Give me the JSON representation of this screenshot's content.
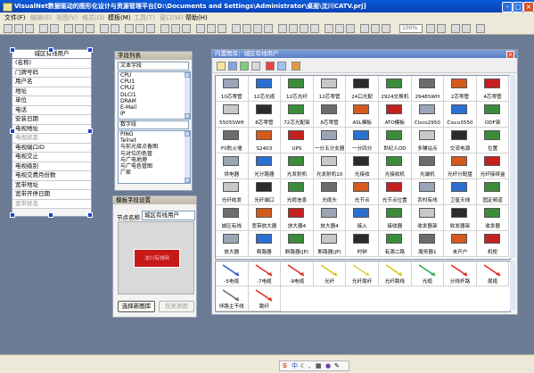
{
  "window": {
    "title": "VisualNet数据驱动的图形化设计与资源管理平台[D:\\Documents and Settings\\Administrator\\桌面\\沈川CATV.prj]"
  },
  "menu": [
    {
      "label": "文件(F)",
      "enabled": true
    },
    {
      "label": "编辑(E)",
      "enabled": false
    },
    {
      "label": "视图(V)",
      "enabled": false
    },
    {
      "label": "格式(O)",
      "enabled": false
    },
    {
      "label": "模板(M)",
      "enabled": true
    },
    {
      "label": "工具(T)",
      "enabled": false
    },
    {
      "label": "窗口(W)",
      "enabled": false
    },
    {
      "label": "帮助(H)",
      "enabled": true
    }
  ],
  "toolbar": {
    "zoom": "100%"
  },
  "form_panel": {
    "title": "城区有线用户",
    "rows": [
      {
        "label": "(名称)",
        "dim": false
      },
      {
        "label": "门牌号码",
        "dim": false
      },
      {
        "label": "用户名",
        "dim": false
      },
      {
        "label": "地址",
        "dim": false
      },
      {
        "label": "单位",
        "dim": false
      },
      {
        "label": "电话",
        "dim": false
      },
      {
        "label": "安装日期",
        "dim": false
      },
      {
        "label": "电视地址",
        "dim": false
      },
      {
        "label": "电视状态",
        "dim": true
      },
      {
        "label": "电视端口ID",
        "dim": false
      },
      {
        "label": "电视交止",
        "dim": false
      },
      {
        "label": "电视级别",
        "dim": false
      },
      {
        "label": "电视交费月份数",
        "dim": false
      },
      {
        "label": "宽带地址",
        "dim": false
      },
      {
        "label": "宽带开停日期",
        "dim": false
      },
      {
        "label": "宽带状态",
        "dim": true
      }
    ]
  },
  "field_list": {
    "title": "字段列表",
    "combo1": "文本字段",
    "list1": [
      "CPU",
      "CPU1",
      "CPU2",
      "DLCI1",
      "DRAM",
      "E-Mail",
      "IP"
    ],
    "combo2": "数字段",
    "list2": [
      "PING",
      "Telnet",
      "与前光接点备图",
      "与对位的色管",
      "与广电地理",
      "与广电色管图",
      "厂家"
    ]
  },
  "template_settings": {
    "title": "模板字段设置",
    "name_label": "节点名称",
    "name_value": "城区有线用户",
    "preview_text": "沈川有线网",
    "select_btn": "选择新图库",
    "restore_btn": "恢复原图"
  },
  "library": {
    "title": "内置图库：城区有线用户",
    "rows": [
      [
        "10芯零管",
        "12芯光缆",
        "12芯光纤",
        "12芯零管",
        "24口光配",
        "2924交换机",
        "2948SWH",
        "2芯零管",
        "4芯零管"
      ],
      [
        "5505SWH",
        "8芯零管",
        "72芯光配架",
        "8芯零管",
        "ASL模板",
        "ATO模板",
        "Cisco2950",
        "Cisco3550",
        "ODF架"
      ],
      [
        "F0防火墙",
        "S2403",
        "UPS",
        "一分五分支器",
        "一分四分",
        "世纪人OD",
        "多辅站点",
        "交流电源",
        "位置"
      ],
      [
        "供电器",
        "光分路器",
        "光发射机",
        "光发射机10",
        "光接收",
        "光接收机",
        "光端机",
        "光纤分配盘",
        "光纤接续盒"
      ],
      [
        "光纤收发",
        "光纤端口",
        "光缆信息",
        "光缆头",
        "光节点",
        "光节点位置",
        "农村有线",
        "卫星天线",
        "固定频道"
      ],
      [
        "城区有线",
        "宽带放大器",
        "放大器4",
        "放大器4",
        "接入",
        "接收器",
        "收发器架",
        "收发器架",
        "收发器"
      ],
      [
        "放大器",
        "断路器",
        "断路器(JP)",
        "断路器(JP)",
        "时钟",
        "有源二路",
        "服务器1",
        "未开户",
        "机柜"
      ]
    ],
    "lines": [
      [
        "-5电缆",
        "-7电缆",
        "-9电缆",
        "光纤",
        "光纤尾纤",
        "光纤跳线",
        "光缆",
        "分线杆路",
        "尾缆"
      ],
      [
        "伴路主干线",
        "跳纤"
      ]
    ],
    "line_colors": [
      "#2c5bd6",
      "#e02a1e",
      "#e02a1e",
      "#d6c21c",
      "#e3d24a",
      "#d6c21c",
      "#2aa84a",
      "#e02a1e",
      "#e02a1e",
      "#6b6b6b",
      "#e02a1e"
    ],
    "icon_colors": [
      "#9aa6b8",
      "#2b6fd3",
      "#3a8c3a",
      "#c8c8c8",
      "#2b2b2b",
      "#3a8c3a",
      "#6c6c6c",
      "#d45a1e",
      "#c42020"
    ]
  },
  "taskbar": {
    "ime": "中"
  }
}
